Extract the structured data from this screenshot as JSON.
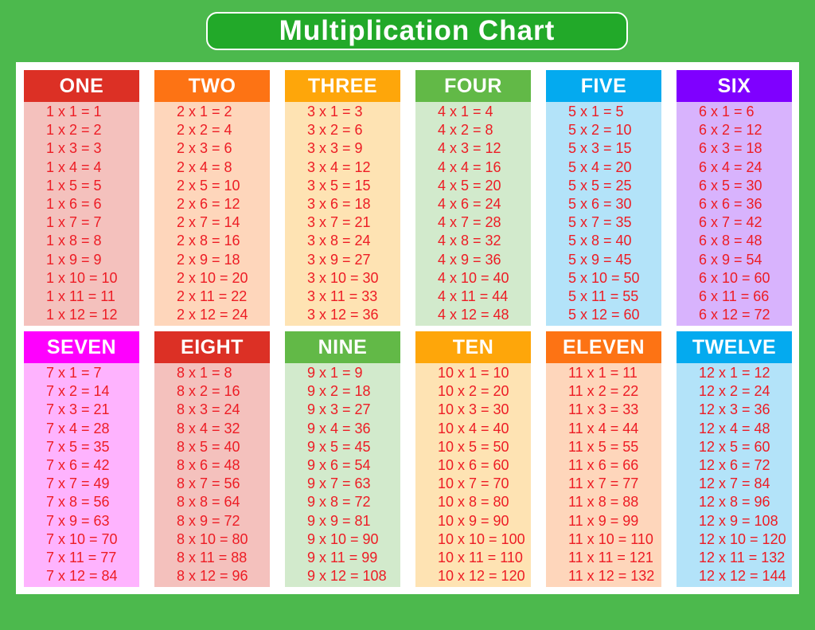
{
  "title": "Multiplication Chart",
  "colors": {
    "background": "#4cb94d",
    "title_box": "#22a929",
    "fact_text": "#ed1c24"
  },
  "tables": [
    {
      "name": "ONE",
      "header_color": "#dc3025",
      "body_color": "#f4c1bd",
      "facts": [
        "1 x 1 = 1",
        "1 x 2 = 2",
        "1 x 3 = 3",
        "1 x 4 = 4",
        "1 x 5 = 5",
        "1 x 6 = 6",
        "1 x 7 = 7",
        "1 x 8 = 8",
        "1 x 9 = 9",
        "1 x 10 = 10",
        "1 x 11 = 11",
        "1 x 12 = 12"
      ]
    },
    {
      "name": "TWO",
      "header_color": "#fd7314",
      "body_color": "#fed6bb",
      "facts": [
        "2 x 1 = 2",
        "2 x 2 = 4",
        "2 x 3 = 6",
        "2 x 4 = 8",
        "2 x 5 = 10",
        "2 x 6 = 12",
        "2 x 7 = 14",
        "2 x 8 = 16",
        "2 x 9 = 18",
        "2 x 10 = 20",
        "2 x 11 = 22",
        "2 x 12 = 24"
      ]
    },
    {
      "name": "THREE",
      "header_color": "#fea60a",
      "body_color": "#fee3b3",
      "facts": [
        "3 x 1 = 3",
        "3 x 2 = 6",
        "3 x 3 = 9",
        "3 x 4 = 12",
        "3 x 5 = 15",
        "3 x 6 = 18",
        "3 x 7 = 21",
        "3 x 8 = 24",
        "3 x 9 = 27",
        "3 x 10 = 30",
        "3 x 11 = 33",
        "3 x 12 = 36"
      ]
    },
    {
      "name": "FOUR",
      "header_color": "#62b947",
      "body_color": "#d2eacc",
      "facts": [
        "4 x 1 = 4",
        "4 x 2 = 8",
        "4 x 3 = 12",
        "4 x 4 = 16",
        "4 x 5 = 20",
        "4 x 6 = 24",
        "4 x 7 = 28",
        "4 x 8 = 32",
        "4 x 9 = 36",
        "4 x 10 = 40",
        "4 x 11 = 44",
        "4 x 12 = 48"
      ]
    },
    {
      "name": "FIVE",
      "header_color": "#04aaef",
      "body_color": "#b3e3f9",
      "facts": [
        "5 x 1 = 5",
        "5 x 2 = 10",
        "5 x 3 = 15",
        "5 x 4 = 20",
        "5 x 5 = 25",
        "5 x 6 = 30",
        "5 x 7 = 35",
        "5 x 8 = 40",
        "5 x 9 = 45",
        "5 x 10 = 50",
        "5 x 11 = 55",
        "5 x 12 = 60"
      ]
    },
    {
      "name": "SIX",
      "header_color": "#7f00ff",
      "body_color": "#d8b3fd",
      "facts": [
        "6 x 1 = 6",
        "6 x 2 = 12",
        "6 x 3 = 18",
        "6 x 4 = 24",
        "6 x 5 = 30",
        "6 x 6 = 36",
        "6 x 7 = 42",
        "6 x 8 = 48",
        "6 x 9 = 54",
        "6 x 10 = 60",
        "6 x 11 = 66",
        "6 x 12 = 72"
      ]
    },
    {
      "name": "SEVEN",
      "header_color": "#fe00fe",
      "body_color": "#feb3fe",
      "facts": [
        "7 x 1 = 7",
        "7 x 2 = 14",
        "7 x 3 = 21",
        "7 x 4 = 28",
        "7 x 5 = 35",
        "7 x 6 = 42",
        "7 x 7 = 49",
        "7 x 8 = 56",
        "7 x 9 = 63",
        "7 x 10 = 70",
        "7 x 11 = 77",
        "7 x 12 = 84"
      ]
    },
    {
      "name": "EIGHT",
      "header_color": "#dc3025",
      "body_color": "#f4c1bd",
      "facts": [
        "8 x 1 = 8",
        "8 x 2 = 16",
        "8 x 3 = 24",
        "8 x 4 = 32",
        "8 x 5 = 40",
        "8 x 6 = 48",
        "8 x 7 = 56",
        "8 x 8 = 64",
        "8 x 9 = 72",
        "8 x 10 = 80",
        "8 x 11 = 88",
        "8 x 12 = 96"
      ]
    },
    {
      "name": "NINE",
      "header_color": "#62b947",
      "body_color": "#d2eacc",
      "facts": [
        "9 x 1 = 9",
        "9 x 2 = 18",
        "9 x 3 = 27",
        "9 x 4 = 36",
        "9 x 5 = 45",
        "9 x 6 = 54",
        "9 x 7 = 63",
        "9 x 8 = 72",
        "9 x 9 = 81",
        "9 x 10 = 90",
        "9 x 11 = 99",
        "9 x 12 = 108"
      ]
    },
    {
      "name": "TEN",
      "header_color": "#fea60a",
      "body_color": "#fee3b3",
      "facts": [
        "10 x 1 = 10",
        "10 x 2 = 20",
        "10 x 3 = 30",
        "10 x 4 = 40",
        "10 x 5 = 50",
        "10 x 6 = 60",
        "10 x 7 = 70",
        "10 x 8 = 80",
        "10 x 9 = 90",
        "10 x 10 = 100",
        "10 x 11 = 110",
        "10 x 12 = 120"
      ]
    },
    {
      "name": "ELEVEN",
      "header_color": "#fd7314",
      "body_color": "#fed6bb",
      "facts": [
        "11 x 1 = 11",
        "11 x 2 = 22",
        "11 x 3 = 33",
        "11 x 4 = 44",
        "11 x 5 = 55",
        "11 x 6 = 66",
        "11 x 7 = 77",
        "11 x 8 = 88",
        "11 x 9 = 99",
        "11 x 10 = 110",
        "11 x 11 = 121",
        "11 x 12 = 132"
      ]
    },
    {
      "name": "TWELVE",
      "header_color": "#04aaef",
      "body_color": "#b3e3f9",
      "facts": [
        "12 x 1 = 12",
        "12 x 2 = 24",
        "12 x 3 = 36",
        "12 x 4 = 48",
        "12 x 5 = 60",
        "12 x 6 = 72",
        "12 x 7 = 84",
        "12 x 8 = 96",
        "12 x 9 = 108",
        "12 x 10 = 120",
        "12 x 11 = 132",
        "12 x 12 = 144"
      ]
    }
  ]
}
